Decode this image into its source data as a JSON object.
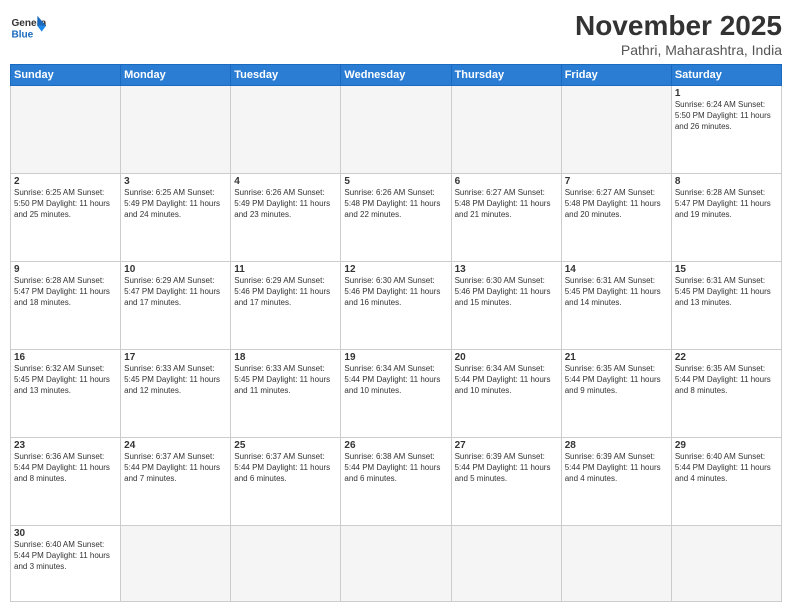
{
  "header": {
    "logo_general": "General",
    "logo_blue": "Blue",
    "month_title": "November 2025",
    "location": "Pathri, Maharashtra, India"
  },
  "days_of_week": [
    "Sunday",
    "Monday",
    "Tuesday",
    "Wednesday",
    "Thursday",
    "Friday",
    "Saturday"
  ],
  "weeks": [
    [
      {
        "day": "",
        "info": ""
      },
      {
        "day": "",
        "info": ""
      },
      {
        "day": "",
        "info": ""
      },
      {
        "day": "",
        "info": ""
      },
      {
        "day": "",
        "info": ""
      },
      {
        "day": "",
        "info": ""
      },
      {
        "day": "1",
        "info": "Sunrise: 6:24 AM\nSunset: 5:50 PM\nDaylight: 11 hours\nand 26 minutes."
      }
    ],
    [
      {
        "day": "2",
        "info": "Sunrise: 6:25 AM\nSunset: 5:50 PM\nDaylight: 11 hours\nand 25 minutes."
      },
      {
        "day": "3",
        "info": "Sunrise: 6:25 AM\nSunset: 5:49 PM\nDaylight: 11 hours\nand 24 minutes."
      },
      {
        "day": "4",
        "info": "Sunrise: 6:26 AM\nSunset: 5:49 PM\nDaylight: 11 hours\nand 23 minutes."
      },
      {
        "day": "5",
        "info": "Sunrise: 6:26 AM\nSunset: 5:48 PM\nDaylight: 11 hours\nand 22 minutes."
      },
      {
        "day": "6",
        "info": "Sunrise: 6:27 AM\nSunset: 5:48 PM\nDaylight: 11 hours\nand 21 minutes."
      },
      {
        "day": "7",
        "info": "Sunrise: 6:27 AM\nSunset: 5:48 PM\nDaylight: 11 hours\nand 20 minutes."
      },
      {
        "day": "8",
        "info": "Sunrise: 6:28 AM\nSunset: 5:47 PM\nDaylight: 11 hours\nand 19 minutes."
      }
    ],
    [
      {
        "day": "9",
        "info": "Sunrise: 6:28 AM\nSunset: 5:47 PM\nDaylight: 11 hours\nand 18 minutes."
      },
      {
        "day": "10",
        "info": "Sunrise: 6:29 AM\nSunset: 5:47 PM\nDaylight: 11 hours\nand 17 minutes."
      },
      {
        "day": "11",
        "info": "Sunrise: 6:29 AM\nSunset: 5:46 PM\nDaylight: 11 hours\nand 17 minutes."
      },
      {
        "day": "12",
        "info": "Sunrise: 6:30 AM\nSunset: 5:46 PM\nDaylight: 11 hours\nand 16 minutes."
      },
      {
        "day": "13",
        "info": "Sunrise: 6:30 AM\nSunset: 5:46 PM\nDaylight: 11 hours\nand 15 minutes."
      },
      {
        "day": "14",
        "info": "Sunrise: 6:31 AM\nSunset: 5:45 PM\nDaylight: 11 hours\nand 14 minutes."
      },
      {
        "day": "15",
        "info": "Sunrise: 6:31 AM\nSunset: 5:45 PM\nDaylight: 11 hours\nand 13 minutes."
      }
    ],
    [
      {
        "day": "16",
        "info": "Sunrise: 6:32 AM\nSunset: 5:45 PM\nDaylight: 11 hours\nand 13 minutes."
      },
      {
        "day": "17",
        "info": "Sunrise: 6:33 AM\nSunset: 5:45 PM\nDaylight: 11 hours\nand 12 minutes."
      },
      {
        "day": "18",
        "info": "Sunrise: 6:33 AM\nSunset: 5:45 PM\nDaylight: 11 hours\nand 11 minutes."
      },
      {
        "day": "19",
        "info": "Sunrise: 6:34 AM\nSunset: 5:44 PM\nDaylight: 11 hours\nand 10 minutes."
      },
      {
        "day": "20",
        "info": "Sunrise: 6:34 AM\nSunset: 5:44 PM\nDaylight: 11 hours\nand 10 minutes."
      },
      {
        "day": "21",
        "info": "Sunrise: 6:35 AM\nSunset: 5:44 PM\nDaylight: 11 hours\nand 9 minutes."
      },
      {
        "day": "22",
        "info": "Sunrise: 6:35 AM\nSunset: 5:44 PM\nDaylight: 11 hours\nand 8 minutes."
      }
    ],
    [
      {
        "day": "23",
        "info": "Sunrise: 6:36 AM\nSunset: 5:44 PM\nDaylight: 11 hours\nand 8 minutes."
      },
      {
        "day": "24",
        "info": "Sunrise: 6:37 AM\nSunset: 5:44 PM\nDaylight: 11 hours\nand 7 minutes."
      },
      {
        "day": "25",
        "info": "Sunrise: 6:37 AM\nSunset: 5:44 PM\nDaylight: 11 hours\nand 6 minutes."
      },
      {
        "day": "26",
        "info": "Sunrise: 6:38 AM\nSunset: 5:44 PM\nDaylight: 11 hours\nand 6 minutes."
      },
      {
        "day": "27",
        "info": "Sunrise: 6:39 AM\nSunset: 5:44 PM\nDaylight: 11 hours\nand 5 minutes."
      },
      {
        "day": "28",
        "info": "Sunrise: 6:39 AM\nSunset: 5:44 PM\nDaylight: 11 hours\nand 4 minutes."
      },
      {
        "day": "29",
        "info": "Sunrise: 6:40 AM\nSunset: 5:44 PM\nDaylight: 11 hours\nand 4 minutes."
      }
    ],
    [
      {
        "day": "30",
        "info": "Sunrise: 6:40 AM\nSunset: 5:44 PM\nDaylight: 11 hours\nand 3 minutes."
      },
      {
        "day": "",
        "info": ""
      },
      {
        "day": "",
        "info": ""
      },
      {
        "day": "",
        "info": ""
      },
      {
        "day": "",
        "info": ""
      },
      {
        "day": "",
        "info": ""
      },
      {
        "day": "",
        "info": ""
      }
    ]
  ]
}
